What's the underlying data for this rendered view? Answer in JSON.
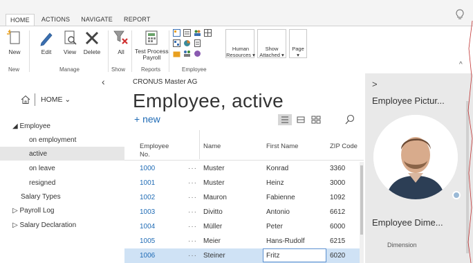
{
  "ribbon": {
    "tabs": [
      "HOME",
      "ACTIONS",
      "NAVIGATE",
      "REPORT"
    ],
    "active_tab": "HOME",
    "buttons": {
      "new": "New",
      "edit": "Edit",
      "view": "View",
      "delete": "Delete",
      "all": "All",
      "test_process_payroll_line1": "Test Process",
      "test_process_payroll_line2": "Payroll",
      "human_resources_line1": "Human",
      "human_resources_line2": "Resources ▾",
      "show_attached_line1": "Show",
      "show_attached_line2": "Attached ▾",
      "page_line1": "Page",
      "page_line2": "▾"
    },
    "groups": {
      "new": "New",
      "manage": "Manage",
      "show": "Show",
      "reports": "Reports",
      "employee": "Employee"
    }
  },
  "nav": {
    "home_label": "HOME ⌄",
    "items": [
      {
        "label": "◢ Employee"
      },
      {
        "label": "on employment"
      },
      {
        "label": "active"
      },
      {
        "label": "on leave"
      },
      {
        "label": "resigned"
      },
      {
        "label": "Salary Types"
      },
      {
        "label": "▷ Payroll Log"
      },
      {
        "label": "▷ Salary Declaration"
      }
    ],
    "selected_index": 2
  },
  "main": {
    "company": "CRONUS Master AG",
    "title": "Employee, active",
    "new_label": "+ new",
    "columns": {
      "employee_no_line1": "Employee",
      "employee_no_line2": "No.",
      "name": "Name",
      "first_name": "First Name",
      "zip": "ZIP Code"
    },
    "rows": [
      {
        "no": "1000",
        "name": "Muster",
        "first_name": "Konrad",
        "zip": "3360"
      },
      {
        "no": "1001",
        "name": "Muster",
        "first_name": "Heinz",
        "zip": "3000"
      },
      {
        "no": "1002",
        "name": "Mauron",
        "first_name": "Fabienne",
        "zip": "1092"
      },
      {
        "no": "1003",
        "name": "Divitto",
        "first_name": "Antonio",
        "zip": "6612"
      },
      {
        "no": "1004",
        "name": "Müller",
        "first_name": "Peter",
        "zip": "6000"
      },
      {
        "no": "1005",
        "name": "Meier",
        "first_name": "Hans-Rudolf",
        "zip": "6215"
      },
      {
        "no": "1006",
        "name": "Steiner",
        "first_name": "Fritz",
        "zip": "6020"
      }
    ],
    "row_dots": "···",
    "selected_row": 6
  },
  "factbox": {
    "chevron": ">",
    "picture_title": "Employee Pictur...",
    "dimensions_title": "Employee Dime...",
    "dimension_label": "Dimension"
  },
  "colors": {
    "accent": "#1f6bb5",
    "selected_row": "#cfe2f5",
    "nav_selected": "#e6e6e6",
    "factbox_bg": "#e9e9e9"
  }
}
